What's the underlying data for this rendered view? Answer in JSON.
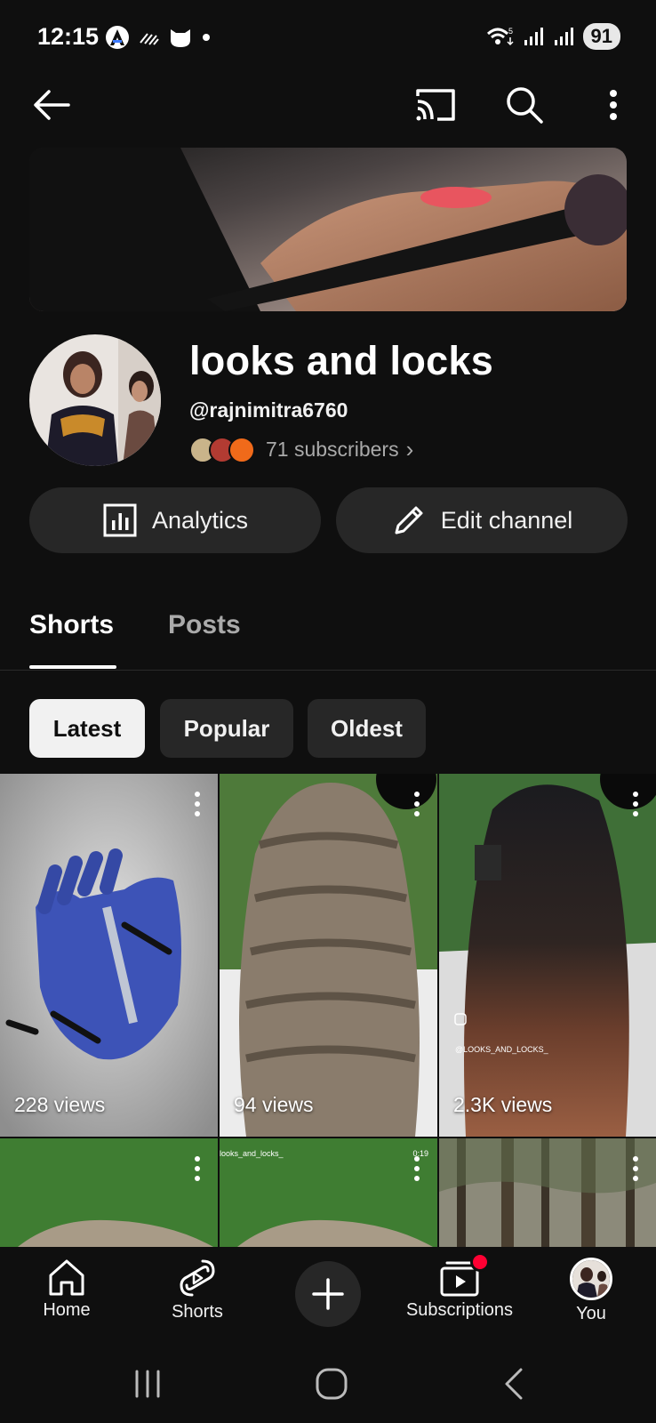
{
  "status_bar": {
    "time": "12:15",
    "battery": "91",
    "icons_left": [
      "android-auto-icon",
      "signal-stripes-icon",
      "cat-mask-icon",
      "dot-icon"
    ],
    "icons_right": [
      "wifi-icon",
      "signal-icon",
      "signal-icon"
    ]
  },
  "app_bar": {
    "icons": [
      "back-arrow-icon",
      "cast-icon",
      "search-icon",
      "more-vert-icon"
    ]
  },
  "channel": {
    "name": "looks and locks",
    "handle": "@rajnimitra6760",
    "subscribers": "71 subscribers",
    "sub_chevron": "›"
  },
  "actions": {
    "analytics": "Analytics",
    "edit": "Edit channel"
  },
  "tabs": [
    {
      "label": "Shorts",
      "active": true
    },
    {
      "label": "Posts",
      "active": false
    }
  ],
  "chips": [
    {
      "label": "Latest",
      "active": true
    },
    {
      "label": "Popular",
      "active": false
    },
    {
      "label": "Oldest",
      "active": false
    }
  ],
  "shorts": [
    {
      "views": "228 views"
    },
    {
      "views": "94 views"
    },
    {
      "views": "2.3K views",
      "watermark": "@LOOKS_AND_LOCKS_"
    },
    {
      "views": "",
      "caption": ""
    },
    {
      "views": "",
      "caption": "looks_and_locks_",
      "duration": "0:19"
    },
    {
      "views": ""
    }
  ],
  "bottom_nav": {
    "home": "Home",
    "shorts": "Shorts",
    "subscriptions": "Subscriptions",
    "you": "You"
  },
  "colors": {
    "background": "#0f0f0f",
    "surface": "#272727",
    "text": "#f1f1f1",
    "secondary_text": "#aaaaaa",
    "badge": "#ff0033"
  }
}
